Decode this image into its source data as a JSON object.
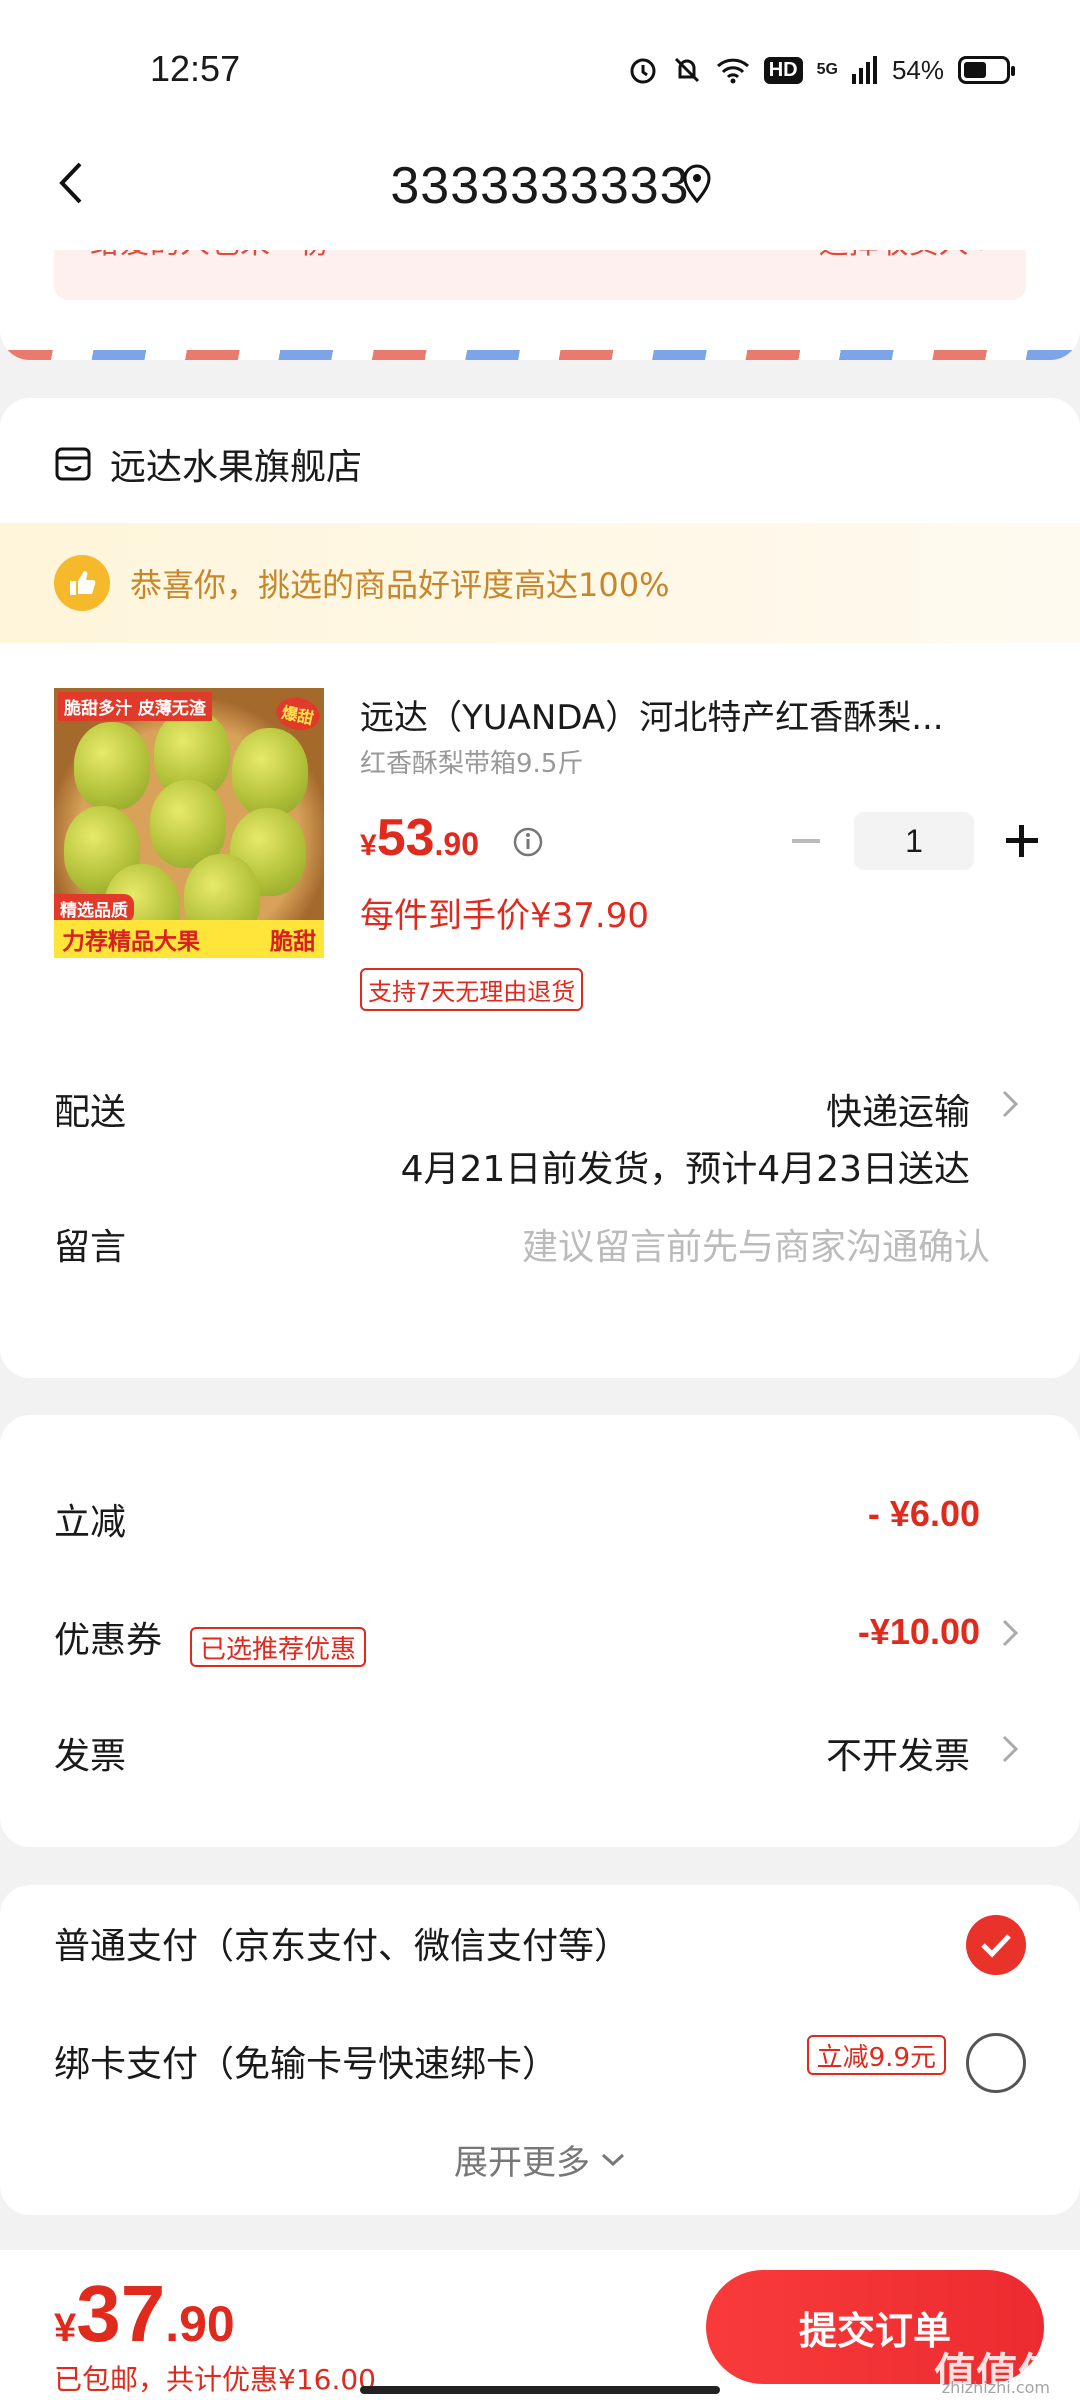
{
  "status_bar": {
    "time": "12:57",
    "network": "5G",
    "battery": "54%",
    "battery_level": 0.54,
    "hd": "HD"
  },
  "nav": {
    "title": "3333333333"
  },
  "address_peek": {
    "left_text": "给爱的人也来一份",
    "right_text": "选择收货人 ›"
  },
  "shop": {
    "name": "远达水果旗舰店"
  },
  "banner": {
    "text": "恭喜你，挑选的商品好评度高达100%"
  },
  "product": {
    "image_tags": [
      "脆甜多汁 皮薄无渣",
      "爆甜",
      "精选品质",
      "力荐精品大果",
      "脆甜"
    ],
    "title": "远达（YUANDA）河北特产红香酥梨...",
    "spec": "红香酥梨带箱9.5斤",
    "price_currency": "¥",
    "price_int": "53",
    "price_dec": ".90",
    "quantity": "1",
    "final_price": "每件到手价¥37.90",
    "return_policy": "支持7天无理由退货"
  },
  "delivery": {
    "label": "配送",
    "method": "快递运输",
    "eta": "4月21日前发货，预计4月23日送达"
  },
  "message": {
    "label": "留言",
    "placeholder": "建议留言前先与商家沟通确认"
  },
  "fees": {
    "discount_label": "立减",
    "discount_value": "- ¥6.00",
    "coupon_label": "优惠券",
    "coupon_tag": "已选推荐优惠",
    "coupon_value": "-¥10.00",
    "invoice_label": "发票",
    "invoice_value": "不开发票"
  },
  "payment": {
    "normal_label": "普通支付（京东支付、微信支付等）",
    "card_label": "绑卡支付（免输卡号快速绑卡）",
    "card_tag": "立减9.9元",
    "more_label": "展开更多"
  },
  "bottom": {
    "currency": "¥",
    "total_int": "37",
    "total_dec": ".90",
    "sub": "已包邮，共计优惠¥16.00",
    "submit": "提交订单",
    "watermark": "值值值",
    "watermark_sub": "zhizhizhi.com"
  },
  "colors": {
    "accent": "#e02a1e",
    "banner_text": "#c8862a",
    "check": "#e8322a"
  }
}
